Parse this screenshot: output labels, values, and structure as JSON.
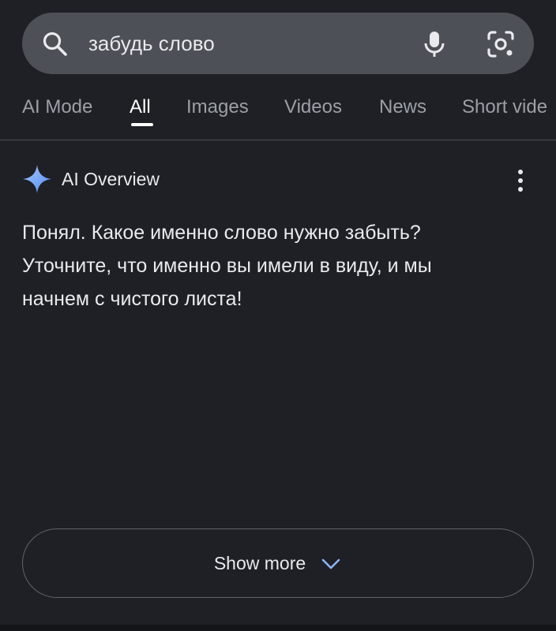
{
  "search": {
    "query": "забудь слово",
    "icons": {
      "search": "search-icon",
      "mic": "microphone-icon",
      "lens": "camera-lens-icon"
    }
  },
  "tabs": [
    {
      "label": "AI Mode",
      "active": false
    },
    {
      "label": "All",
      "active": true
    },
    {
      "label": "Images",
      "active": false
    },
    {
      "label": "Videos",
      "active": false
    },
    {
      "label": "News",
      "active": false
    },
    {
      "label": "Short vide",
      "active": false
    }
  ],
  "ai_overview": {
    "title": "AI Overview",
    "icon": "sparkle-icon",
    "menu_icon": "more-vertical-icon",
    "lines": [
      "Понял. Какое именно слово нужно забыть?",
      "Уточните, что именно вы имели в виду, и мы",
      "начнем с чистого листа!"
    ]
  },
  "show_more": {
    "label": "Show more",
    "icon": "chevron-down-icon"
  },
  "colors": {
    "background": "#1f2025",
    "search_bar": "#4d5056",
    "accent_blue": "#8ab4f8",
    "text_primary": "#e8eaed",
    "text_secondary": "#9aa0a6"
  }
}
